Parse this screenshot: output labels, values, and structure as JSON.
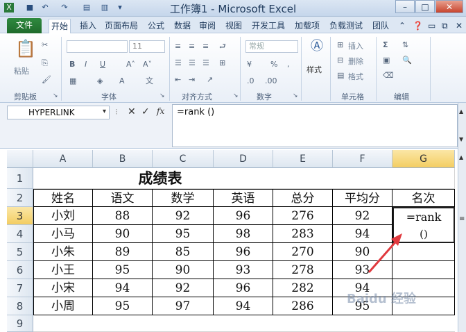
{
  "window": {
    "title": "工作簿1 - Microsoft Excel",
    "controls": [
      "–",
      "□",
      "✕"
    ]
  },
  "tabs": [
    "文件",
    "开始",
    "插入",
    "页面布局",
    "公式",
    "数据",
    "审阅",
    "视图",
    "开发工具",
    "加载项",
    "负载测试",
    "团队"
  ],
  "ribbon": {
    "groups": [
      "剪贴板",
      "字体",
      "对齐方式",
      "数字",
      "单元格",
      "编辑"
    ],
    "paste": "粘贴",
    "font_size": "11",
    "number_format": "常规",
    "styles": "样式",
    "insert": "插入",
    "delete": "删除",
    "format": "格式",
    "percent": "%"
  },
  "formula_bar": {
    "name_box": "HYPERLINK",
    "fx": "fx",
    "formula": "=rank ()"
  },
  "columns": [
    "A",
    "B",
    "C",
    "D",
    "E",
    "F",
    "G"
  ],
  "rows": [
    "1",
    "2",
    "3",
    "4",
    "5",
    "6",
    "7",
    "8",
    "9"
  ],
  "sheet": {
    "title": "成绩表",
    "headers": [
      "姓名",
      "语文",
      "数学",
      "英语",
      "总分",
      "平均分",
      "名次"
    ],
    "data": [
      [
        "小刘",
        "88",
        "92",
        "96",
        "276",
        "92"
      ],
      [
        "小马",
        "90",
        "95",
        "98",
        "283",
        "94"
      ],
      [
        "小朱",
        "89",
        "85",
        "96",
        "270",
        "90"
      ],
      [
        "小王",
        "95",
        "90",
        "93",
        "278",
        "93"
      ],
      [
        "小宋",
        "94",
        "92",
        "96",
        "282",
        "94"
      ],
      [
        "小周",
        "95",
        "97",
        "94",
        "286",
        "95"
      ]
    ],
    "active_cell_line1": "=rank",
    "active_cell_line2": "()"
  },
  "watermark": "Baidu 经验",
  "colors": {
    "file_tab": "#1f6b2c",
    "selected_header": "#f3cd62",
    "arrow": "#e0393e"
  }
}
